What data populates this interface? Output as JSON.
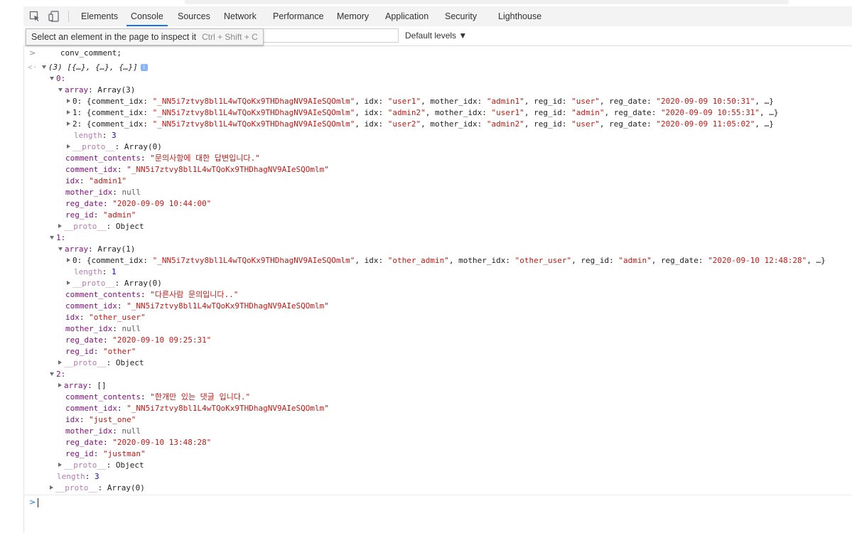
{
  "devtools": {
    "tabs": [
      "Elements",
      "Console",
      "Sources",
      "Network",
      "Performance",
      "Memory",
      "Application",
      "Security",
      "Lighthouse"
    ],
    "active_tab": "Console",
    "icons": [
      "inspect-element-icon",
      "device-toolbar-icon"
    ],
    "accent_color": "#1a73e8"
  },
  "filterbar": {
    "levels_label": "Default levels ▼",
    "tooltip_text": "Select an element in the page to inspect it",
    "tooltip_shortcut": "Ctrl + Shift + C"
  },
  "console": {
    "command": "conv_comment;",
    "summary": "(3) [{…}, {…}, {…}]",
    "info_badge": "i",
    "items": [
      {
        "index_label": "0:",
        "array_key": "array",
        "array_label": "Array(3)",
        "entries": [
          {
            "idx_label": "0:",
            "comment_idx": "\"_NN5i7ztvy8bl1L4wTQoKx9THDhagNV9AIeSQOmlm\"",
            "idx": "\"user1\"",
            "mother_idx": "\"admin1\"",
            "reg_id": "\"user\"",
            "reg_date": "\"2020-09-09 10:50:31\""
          },
          {
            "idx_label": "1:",
            "comment_idx": "\"_NN5i7ztvy8bl1L4wTQoKx9THDhagNV9AIeSQOmlm\"",
            "idx": "\"admin2\"",
            "mother_idx": "\"user1\"",
            "reg_id": "\"admin\"",
            "reg_date": "\"2020-09-09 10:55:31\""
          },
          {
            "idx_label": "2:",
            "comment_idx": "\"_NN5i7ztvy8bl1L4wTQoKx9THDhagNV9AIeSQOmlm\"",
            "idx": "\"user2\"",
            "mother_idx": "\"admin2\"",
            "reg_id": "\"user\"",
            "reg_date": "\"2020-09-09 11:05:02\""
          }
        ],
        "array_length": "3",
        "array_proto": "Array(0)",
        "comment_contents": "\"문의사항에 대한 답변입니다.\"",
        "comment_idx": "\"_NN5i7ztvy8bl1L4wTQoKx9THDhagNV9AIeSQOmlm\"",
        "idx": "\"admin1\"",
        "mother_idx": "null",
        "reg_date": "\"2020-09-09 10:44:00\"",
        "reg_id": "\"admin\"",
        "proto": "Object"
      },
      {
        "index_label": "1:",
        "array_key": "array",
        "array_label": "Array(1)",
        "entries": [
          {
            "idx_label": "0:",
            "comment_idx": "\"_NN5i7ztvy8bl1L4wTQoKx9THDhagNV9AIeSQOmlm\"",
            "idx": "\"other_admin\"",
            "mother_idx": "\"other_user\"",
            "reg_id": "\"admin\"",
            "reg_date": "\"2020-09-10 12:48:28\""
          }
        ],
        "array_length": "1",
        "array_proto": "Array(0)",
        "comment_contents": "\"다른사람 문의입니다..\"",
        "comment_idx": "\"_NN5i7ztvy8bl1L4wTQoKx9THDhagNV9AIeSQOmlm\"",
        "idx": "\"other_user\"",
        "mother_idx": "null",
        "reg_date": "\"2020-09-10 09:25:31\"",
        "reg_id": "\"other\"",
        "proto": "Object"
      },
      {
        "index_label": "2:",
        "array_key": "array",
        "array_label": "[]",
        "comment_contents": "\"한개만 있는 댓글 입니다.\"",
        "comment_idx": "\"_NN5i7ztvy8bl1L4wTQoKx9THDhagNV9AIeSQOmlm\"",
        "idx": "\"just_one\"",
        "mother_idx": "null",
        "reg_date": "\"2020-09-10 13:48:28\"",
        "reg_id": "\"justman\"",
        "proto": "Object"
      }
    ],
    "length": "3",
    "proto": "Array(0)"
  }
}
